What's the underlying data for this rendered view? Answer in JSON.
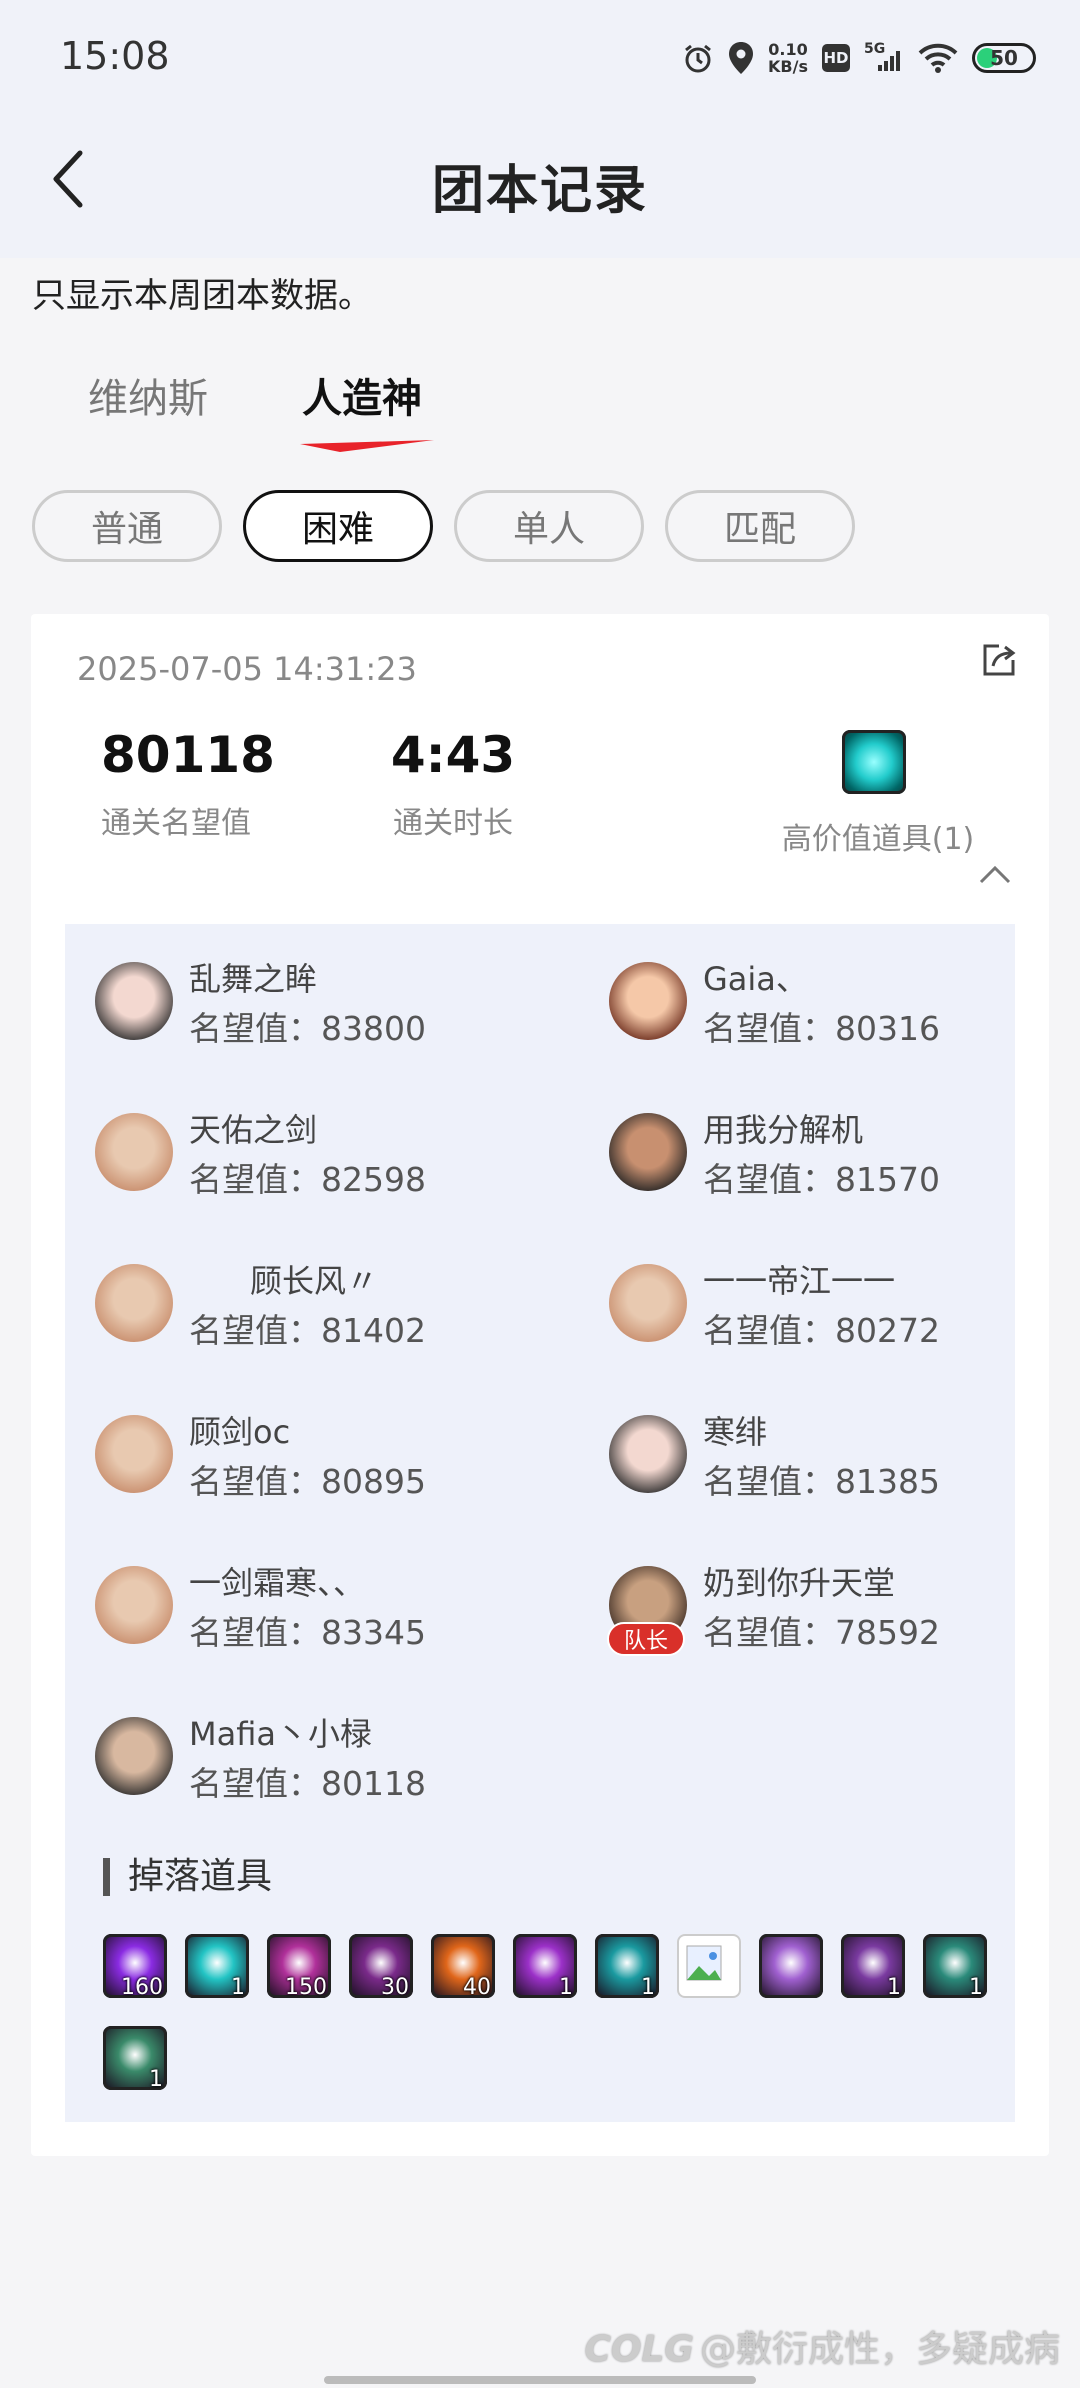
{
  "status_bar": {
    "time": "15:08",
    "net_speed_value": "0.10",
    "net_speed_unit": "KB/s",
    "hd_label": "HD",
    "signal_label": "5G",
    "battery": "50"
  },
  "header": {
    "title": "团本记录"
  },
  "notice": "只显示本周团本数据。",
  "tabs": [
    {
      "label": "维纳斯",
      "active": false
    },
    {
      "label": "人造神",
      "active": true
    }
  ],
  "filters": [
    {
      "label": "普通",
      "active": false
    },
    {
      "label": "困难",
      "active": true
    },
    {
      "label": "单人",
      "active": false
    },
    {
      "label": "匹配",
      "active": false
    }
  ],
  "record": {
    "datetime": "2025-07-05 14:31:23",
    "reputation_value": "80118",
    "reputation_label": "通关名望值",
    "duration_value": "4:43",
    "duration_label": "通关时长",
    "high_value_label": "高价值道具(1)",
    "members": [
      {
        "name": "乱舞之眸",
        "rep": "名望值：83800",
        "leader": false
      },
      {
        "name": "Gaia、",
        "rep": "名望值：80316",
        "leader": false
      },
      {
        "name": "天佑之剑",
        "rep": "名望值：82598",
        "leader": false
      },
      {
        "name": "用我分解机",
        "rep": "名望值：81570",
        "leader": false
      },
      {
        "name": "      顾长风〃",
        "rep": "名望值：81402",
        "leader": false
      },
      {
        "name": "一一帝江一一",
        "rep": "名望值：80272",
        "leader": false
      },
      {
        "name": "顾剑oc",
        "rep": "名望值：80895",
        "leader": false
      },
      {
        "name": "寒绯",
        "rep": "名望值：81385",
        "leader": false
      },
      {
        "name": "一剑霜寒、、",
        "rep": "名望值：83345",
        "leader": false
      },
      {
        "name": "奶到你升天堂",
        "rep": "名望值：78592",
        "leader": true
      },
      {
        "name": "Mafia丶小椂",
        "rep": "名望值：80118",
        "leader": false
      }
    ],
    "leader_badge": "队长",
    "drops_title": "掉落道具",
    "drops": [
      {
        "count": "160",
        "color": "#8a2be2"
      },
      {
        "count": "1",
        "color": "#22c4c4"
      },
      {
        "count": "150",
        "color": "#b0309a"
      },
      {
        "count": "30",
        "color": "#7a2a8a"
      },
      {
        "count": "40",
        "color": "#e0661a"
      },
      {
        "count": "1",
        "color": "#9b30c8"
      },
      {
        "count": "1",
        "color": "#1a9aa0"
      },
      {
        "count": "",
        "color": "#ffffff",
        "broken": true
      },
      {
        "count": "",
        "color": "#a060d0"
      },
      {
        "count": "1",
        "color": "#7a3aa0"
      },
      {
        "count": "1",
        "color": "#2a8a7a"
      },
      {
        "count": "1",
        "color": "#3a8a6a"
      }
    ]
  },
  "watermark": {
    "logo": "COLG",
    "text": "@敷衍成性，多疑成病"
  }
}
